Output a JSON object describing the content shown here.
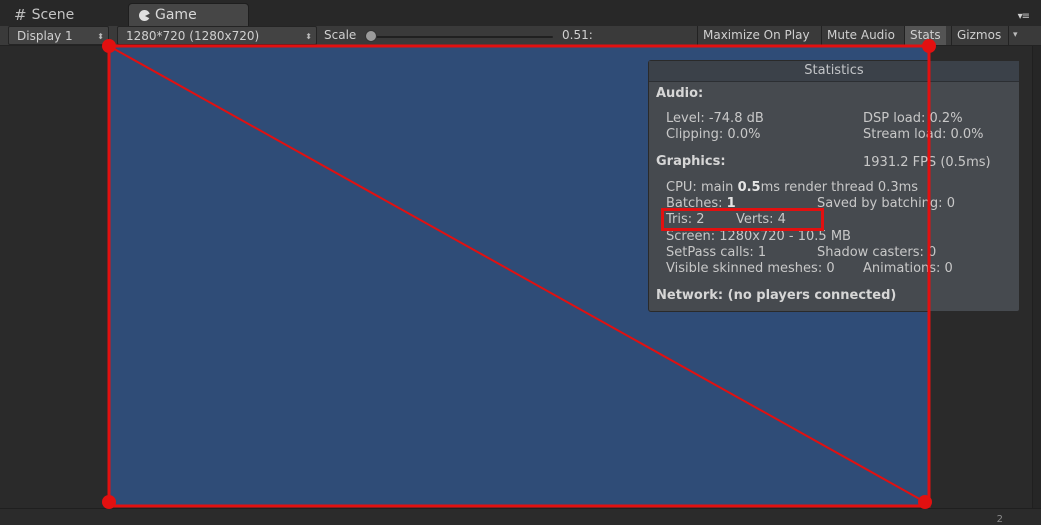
{
  "tabs": {
    "scene_label": "Scene",
    "game_label": "Game"
  },
  "toolbar": {
    "display": "Display 1",
    "resolution": "1280*720 (1280x720)",
    "scale_label": "Scale",
    "scale_value": "0.51:",
    "maximize_on_play": "Maximize On Play",
    "mute_audio": "Mute Audio",
    "stats": "Stats",
    "gizmos": "Gizmos"
  },
  "statistics": {
    "title": "Statistics",
    "audio_heading": "Audio:",
    "level": "Level: -74.8 dB",
    "dsp_load": "DSP load: 0.2%",
    "clipping": "Clipping: 0.0%",
    "stream_load": "Stream load: 0.0%",
    "graphics_heading": "Graphics:",
    "fps": "1931.2 FPS (0.5ms)",
    "cpu_prefix": "CPU: main ",
    "cpu_main": "0.5",
    "cpu_suffix": "ms  render thread 0.3ms",
    "batches_prefix": "Batches: ",
    "batches": "1",
    "saved_by_batching": "Saved by batching: 0",
    "tris": "Tris: 2",
    "verts": "Verts: 4",
    "screen": "Screen: 1280x720 - 10.5 MB",
    "setpass": "SetPass calls: 1",
    "shadow_casters": "Shadow casters: 0",
    "skinned_meshes": "Visible skinned meshes: 0",
    "animations": "Animations: 0",
    "network": "Network: (no players connected)"
  },
  "colors": {
    "game_background": "#2f4c77",
    "annotation_red": "#e21010",
    "panel_background": "#464a4f"
  }
}
